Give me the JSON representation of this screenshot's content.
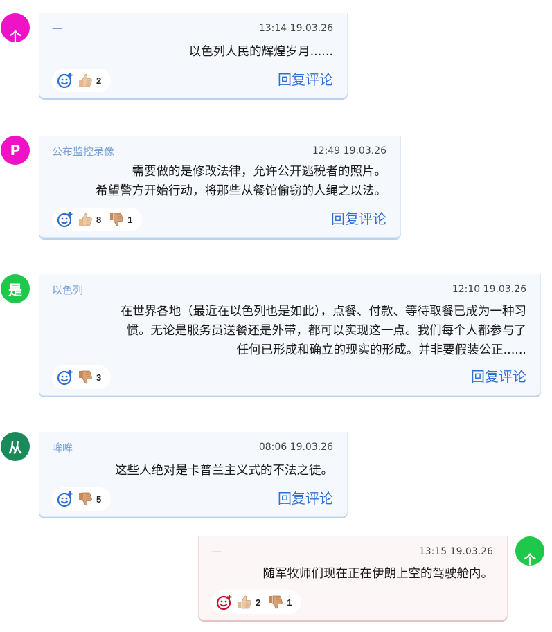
{
  "comments": [
    {
      "avatar_letter": "个",
      "avatar_color": "#f012c6",
      "author": "一",
      "timestamp": "13:14 19.03.26",
      "text_lines": [
        "以色列人民的辉煌岁月......"
      ],
      "likes": "2",
      "dislikes": null,
      "reply_label": "回复评论"
    },
    {
      "avatar_letter": "P",
      "avatar_color": "#f012c6",
      "author": "公布监控录像",
      "timestamp": "12:49 19.03.26",
      "text_lines": [
        "需要做的是修改法律，允许公开逃税者的照片。",
        "希望警方开始行动，将那些从餐馆偷窃的人绳之以法。"
      ],
      "likes": "8",
      "dislikes": "1",
      "reply_label": "回复评论"
    },
    {
      "avatar_letter": "是",
      "avatar_color": "#1fc74a",
      "author": "以色列",
      "timestamp": "12:10 19.03.26",
      "text_lines": [
        "在世界各地（最近在以色列也是如此），点餐、付款、等待取餐已成为一种习",
        "惯。无论是服务员送餐还是外带，都可以实现这一点。我们每个人都参与了",
        "任何已形成和确立的现实的形成。并非要假装公正......"
      ],
      "likes": null,
      "dislikes": "3",
      "reply_label": "回复评论"
    },
    {
      "avatar_letter": "从",
      "avatar_color": "#1a8a5a",
      "author": "哞哞",
      "timestamp": "08:06 19.03.26",
      "text_lines": [
        "这些人绝对是卡普兰主义式的不法之徒。"
      ],
      "likes": null,
      "dislikes": "5",
      "reply_label": "回复评论"
    },
    {
      "avatar_letter": "个",
      "avatar_color": "#1fc74a",
      "author": "一",
      "timestamp": "13:15 19.03.26",
      "text_lines": [
        "随军牧师们现在正在伊朗上空的驾驶舱内。"
      ],
      "likes": "2",
      "dislikes": "1",
      "reply_label": null
    }
  ],
  "icons": {
    "add_reaction": "add-reaction-icon",
    "thumbs_up": "thumbs-up-icon",
    "thumbs_down": "thumbs-down-icon"
  },
  "colors": {
    "accent_blue": "#2f6fd1",
    "author_blue": "#7aa0d6",
    "author_pink": "#d88a8a",
    "own_card_bg": "#fdf6f6",
    "card_bg": "#f5f9fe"
  }
}
